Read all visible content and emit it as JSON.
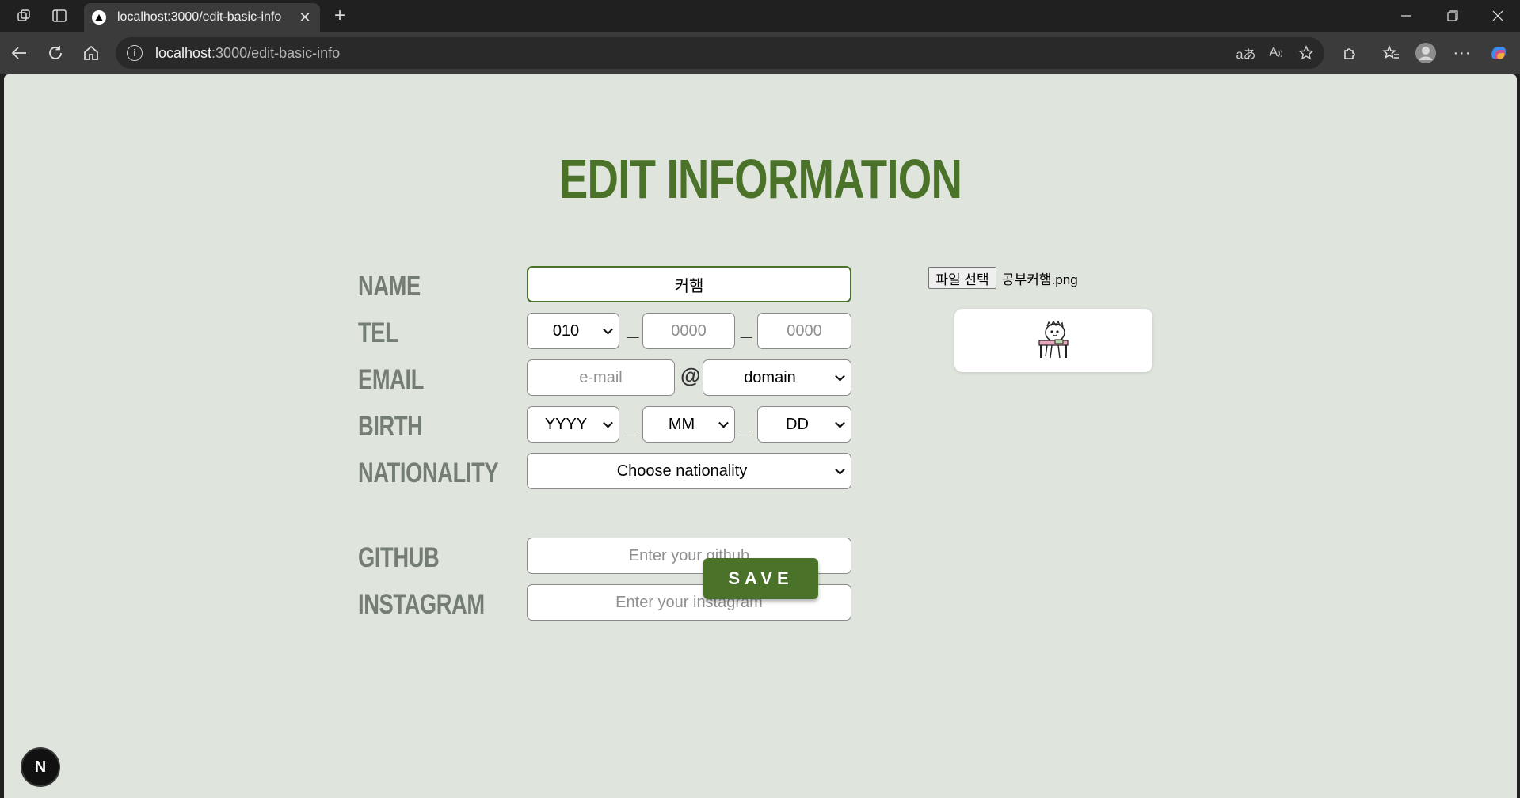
{
  "browser": {
    "tab_title": "localhost:3000/edit-basic-info",
    "url_host": "localhost",
    "url_path": ":3000/edit-basic-info",
    "icons": [
      "workspaces-icon",
      "vertical-tabs-icon",
      "new-tab-icon",
      "minimize-icon",
      "restore-icon",
      "close-icon",
      "back-icon",
      "refresh-icon",
      "home-icon",
      "site-info-icon",
      "translate-icon",
      "read-aloud-icon",
      "favorite-icon",
      "extensions-icon",
      "favorites-icon",
      "profile-icon",
      "more-icon",
      "copilot-icon"
    ]
  },
  "page": {
    "title": "EDIT INFORMATION",
    "labels": {
      "name": "NAME",
      "tel": "TEL",
      "email": "EMAIL",
      "birth": "BIRTH",
      "nationality": "NATIONALITY",
      "github": "GITHUB",
      "instagram": "INSTAGRAM"
    },
    "name_value": "커햄",
    "tel": {
      "prefix": "010",
      "middle_placeholder": "0000",
      "last_placeholder": "0000",
      "separator": "_"
    },
    "email": {
      "placeholder": "e-mail",
      "at": "@",
      "domain": "domain"
    },
    "birth": {
      "year": "YYYY",
      "month": "MM",
      "day": "DD",
      "separator": "_"
    },
    "nationality": "Choose nationality",
    "github_placeholder": "Enter your github",
    "instagram_placeholder": "Enter your instagram",
    "file_button": "파일 선택",
    "file_name": "공부커햄.png",
    "save_label": "SAVE",
    "dev_badge": "N"
  },
  "colors": {
    "accent": "#4b7229",
    "background": "#dfe4dd",
    "label": "#737d74"
  }
}
